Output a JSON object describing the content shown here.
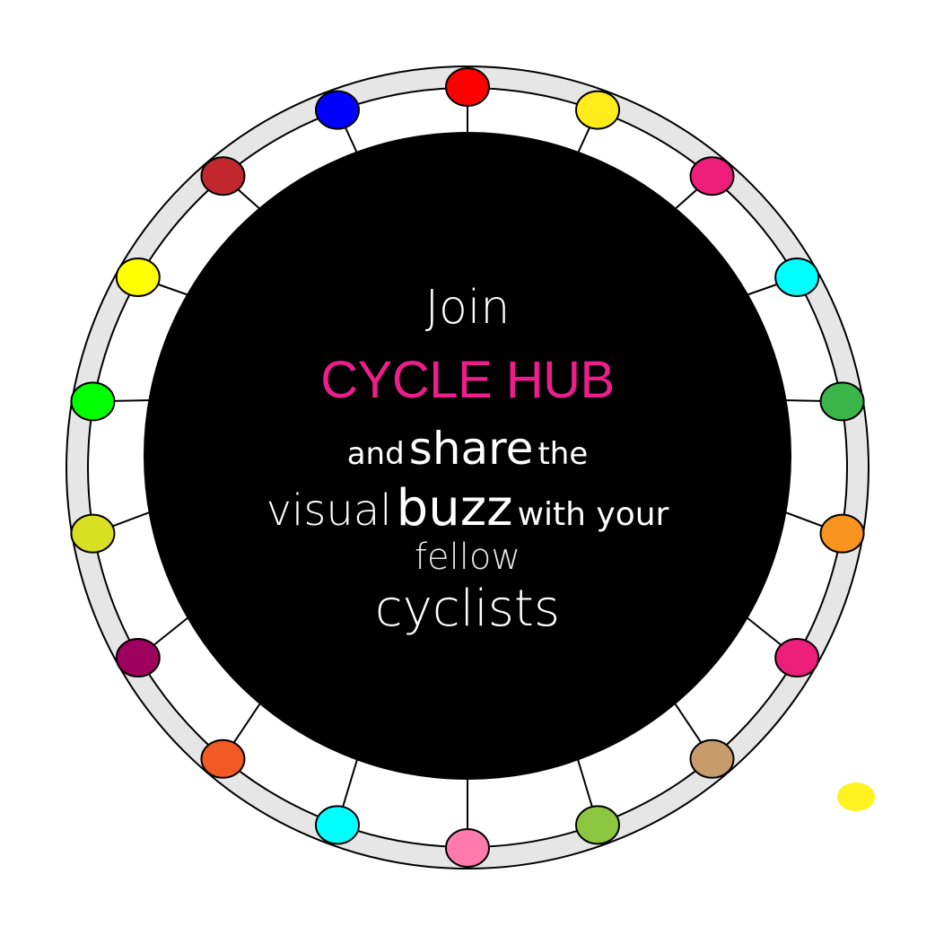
{
  "headline": {
    "join": "Join",
    "brand": "CYCLE HUB",
    "and": "and",
    "share": "share",
    "the": "the",
    "visual": "visual",
    "buzz": "buzz",
    "with_your": "with your",
    "fellow": "fellow",
    "cyclists": "cyclists"
  },
  "colors": {
    "brand": "#ed1e8c",
    "hub": "#000000",
    "rim": "#e6e6e6",
    "stray_dot": "#fff221"
  },
  "dot_colors": [
    "#ff0000",
    "#ffec1a",
    "#ed1e79",
    "#00ffff",
    "#39b54a",
    "#f7931e",
    "#ed1e79",
    "#c69c6d",
    "#8cc63f",
    "#ff7bac",
    "#00ffff",
    "#f15a24",
    "#9e005d",
    "#d9e021",
    "#00ff00",
    "#ffff00",
    "#c1272d",
    "#0000ff"
  ]
}
